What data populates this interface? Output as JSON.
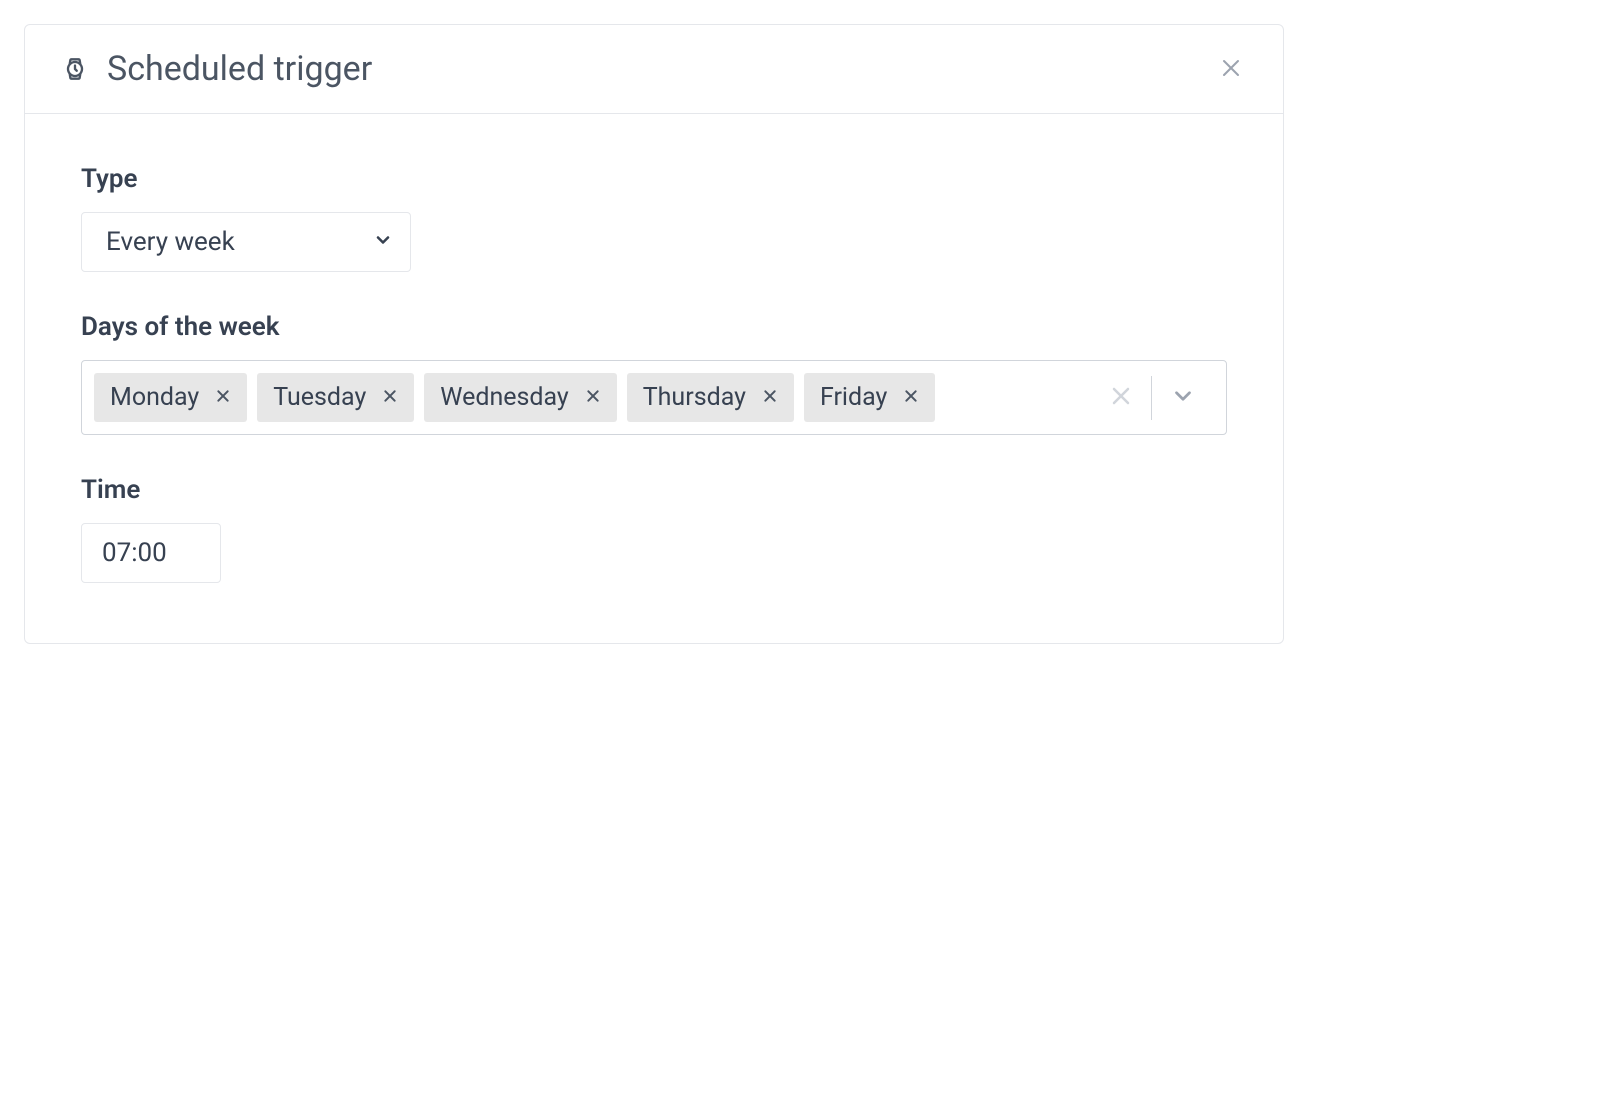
{
  "panel": {
    "title": "Scheduled trigger"
  },
  "fields": {
    "type": {
      "label": "Type",
      "value": "Every week"
    },
    "days": {
      "label": "Days of the week",
      "selected": [
        "Monday",
        "Tuesday",
        "Wednesday",
        "Thursday",
        "Friday"
      ]
    },
    "time": {
      "label": "Time",
      "value": "07:00"
    }
  }
}
